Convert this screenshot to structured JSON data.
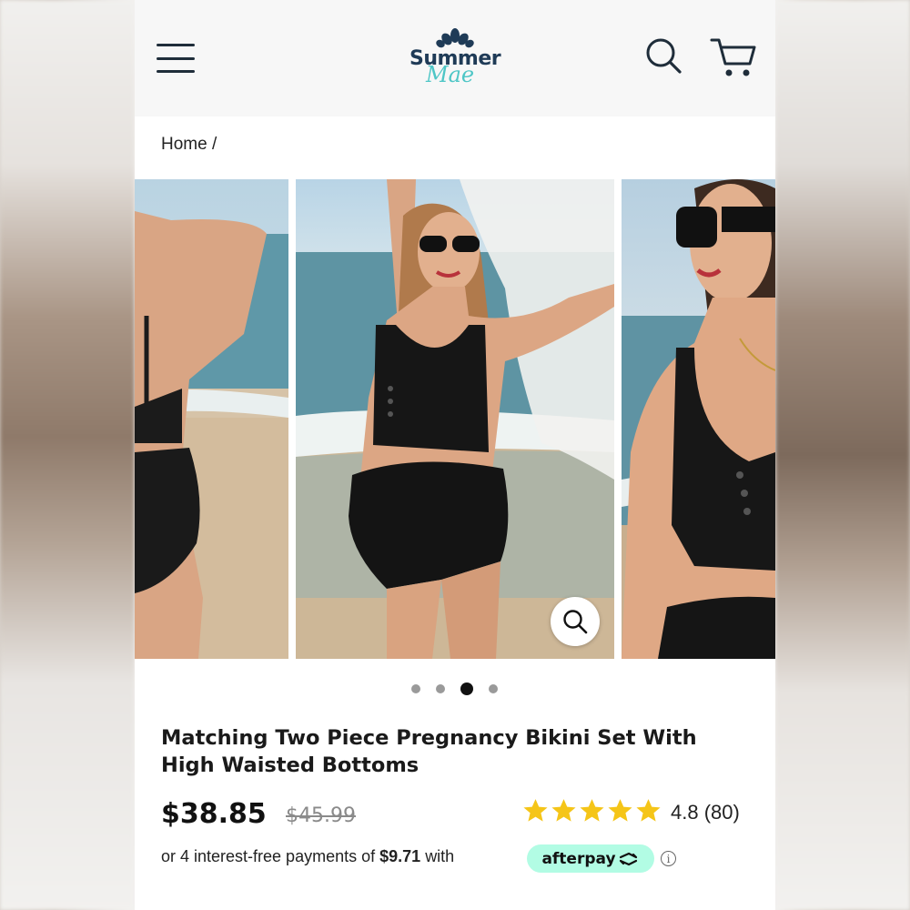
{
  "header": {
    "menu_icon": "hamburger-icon",
    "logo_line1": "Summer",
    "logo_line2": "Mae",
    "search_icon": "search-icon",
    "cart_icon": "cart-icon"
  },
  "breadcrumb": "Home /",
  "gallery": {
    "slide_count": 4,
    "active_index": 2,
    "zoom_icon": "zoom-icon"
  },
  "product": {
    "title": "Matching Two Piece Pregnancy Bikini Set With High Waisted Bottoms",
    "price": "$38.85",
    "compare_price": "$45.99",
    "rating_stars": 5,
    "rating_text": "4.8 (80)",
    "payments_prefix": "or 4 interest-free payments of",
    "payments_amount": "$9.71",
    "payments_suffix": "with",
    "afterpay_label": "afterpay",
    "info_icon": "info-icon"
  },
  "colors": {
    "header_bg": "#f7f7f7",
    "icon_navy": "#1f2d3a",
    "logo_teal": "#4ec6c6",
    "star": "#f5c518",
    "afterpay_mint": "#b2fce4"
  }
}
